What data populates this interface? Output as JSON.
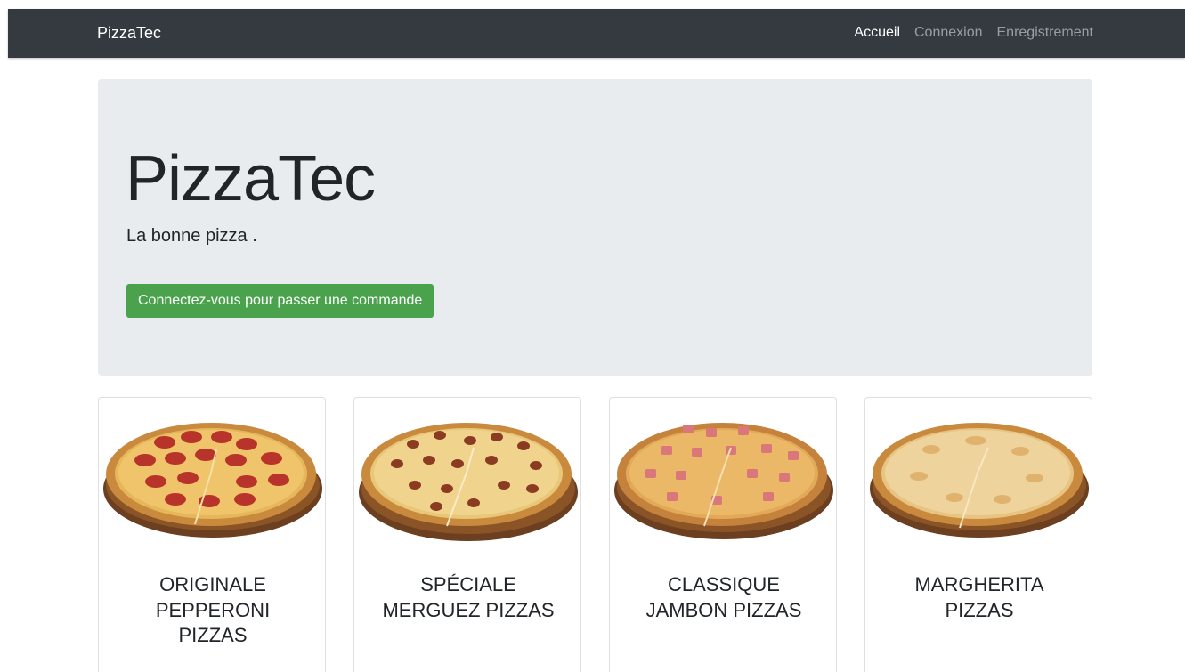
{
  "navbar": {
    "brand": "PizzaTec",
    "links": [
      {
        "label": "Accueil",
        "active": true
      },
      {
        "label": "Connexion",
        "active": false
      },
      {
        "label": "Enregistrement",
        "active": false
      }
    ]
  },
  "hero": {
    "title": "PizzaTec",
    "lead": "La bonne pizza .",
    "button_label": "Connectez-vous pour passer une commande"
  },
  "cards": [
    {
      "title_line1": "ORIGINALE",
      "title_line2": "PEPPERONI",
      "title_line3": "PIZZAS",
      "topping": "pepperoni"
    },
    {
      "title_line1": "SPÉCIALE",
      "title_line2": "MERGUEZ PIZZAS",
      "title_line3": "",
      "topping": "merguez"
    },
    {
      "title_line1": "CLASSIQUE",
      "title_line2": "JAMBON PIZZAS",
      "title_line3": "",
      "topping": "ham"
    },
    {
      "title_line1": "MARGHERITA",
      "title_line2": "PIZZAS",
      "title_line3": "",
      "topping": "cheese"
    }
  ],
  "colors": {
    "navbar_bg": "#343a40",
    "jumbotron_bg": "#e9ecef",
    "button_bg": "#4aa34c"
  }
}
